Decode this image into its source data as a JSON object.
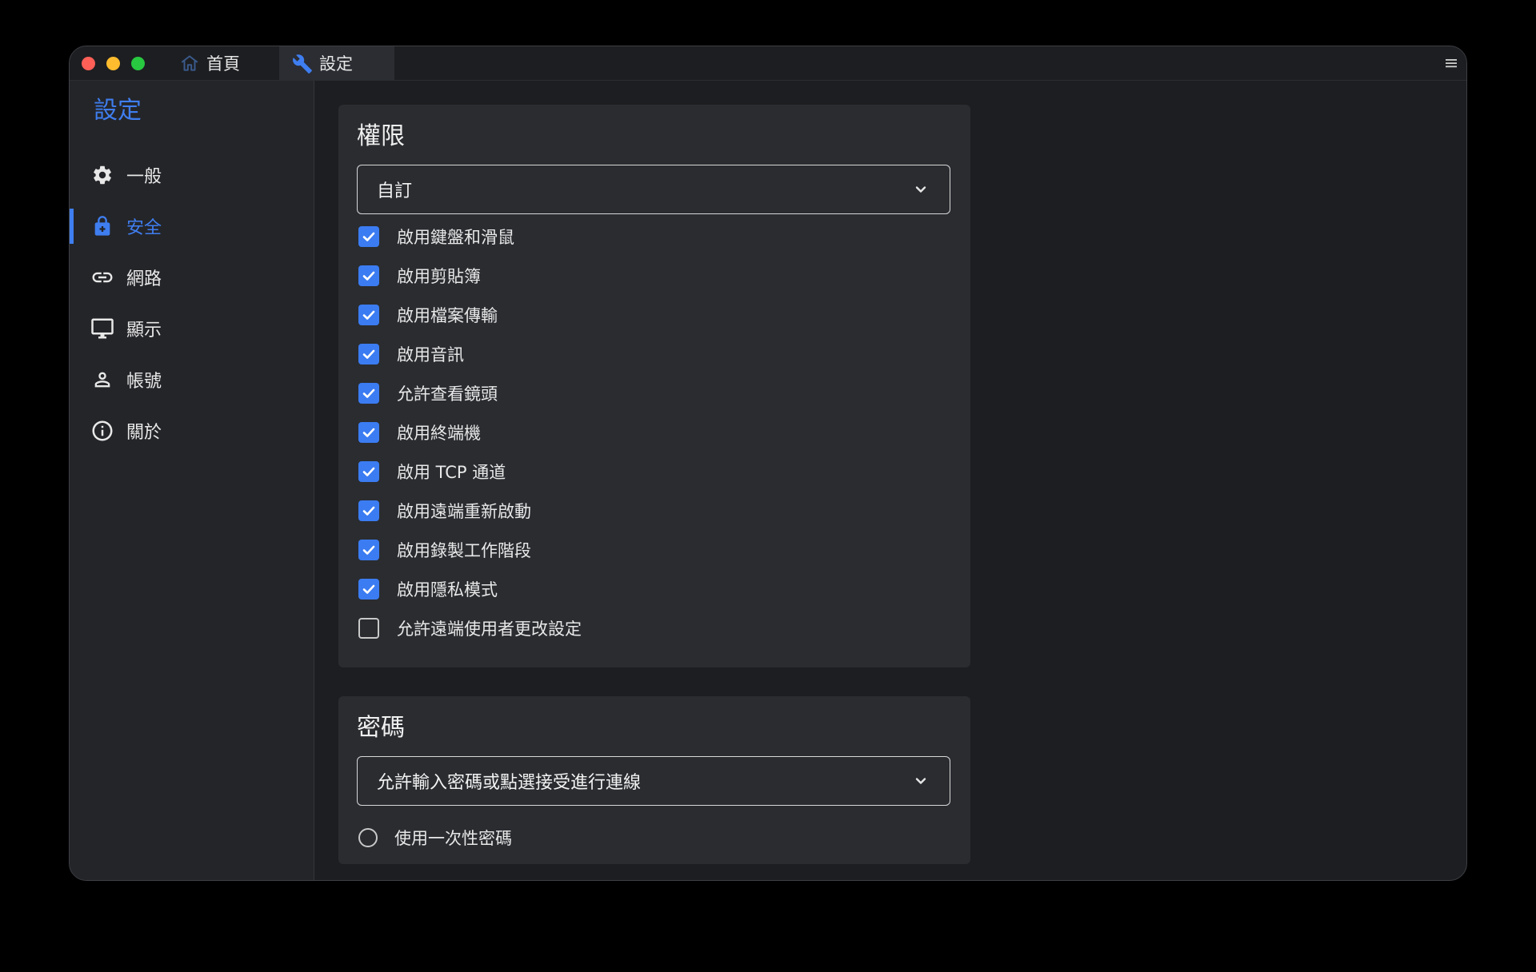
{
  "tabs": [
    {
      "label": "首頁",
      "icon": "home-icon"
    },
    {
      "label": "設定",
      "icon": "wrench-icon"
    }
  ],
  "sidebar": {
    "title": "設定",
    "items": [
      {
        "label": "一般",
        "icon": "gear-icon"
      },
      {
        "label": "安全",
        "icon": "lock-icon",
        "active": true
      },
      {
        "label": "網路",
        "icon": "link-icon"
      },
      {
        "label": "顯示",
        "icon": "monitor-icon"
      },
      {
        "label": "帳號",
        "icon": "person-icon"
      },
      {
        "label": "關於",
        "icon": "info-icon"
      }
    ]
  },
  "permissions": {
    "title": "權限",
    "select_value": "自訂",
    "options": [
      {
        "label": "啟用鍵盤和滑鼠",
        "checked": true
      },
      {
        "label": "啟用剪貼簿",
        "checked": true
      },
      {
        "label": "啟用檔案傳輸",
        "checked": true
      },
      {
        "label": "啟用音訊",
        "checked": true
      },
      {
        "label": "允許查看鏡頭",
        "checked": true
      },
      {
        "label": "啟用終端機",
        "checked": true
      },
      {
        "label": "啟用 TCP 通道",
        "checked": true
      },
      {
        "label": "啟用遠端重新啟動",
        "checked": true
      },
      {
        "label": "啟用錄製工作階段",
        "checked": true
      },
      {
        "label": "啟用隱私模式",
        "checked": true
      },
      {
        "label": "允許遠端使用者更改設定",
        "checked": false
      }
    ]
  },
  "password": {
    "title": "密碼",
    "select_value": "允許輸入密碼或點選接受進行連線",
    "radio_label": "使用一次性密碼",
    "radio_checked": false
  },
  "colors": {
    "accent": "#3f7ef0",
    "window_bg": "#1d1e21",
    "sidebar_bg": "#242529",
    "card_bg": "#2a2c30"
  }
}
